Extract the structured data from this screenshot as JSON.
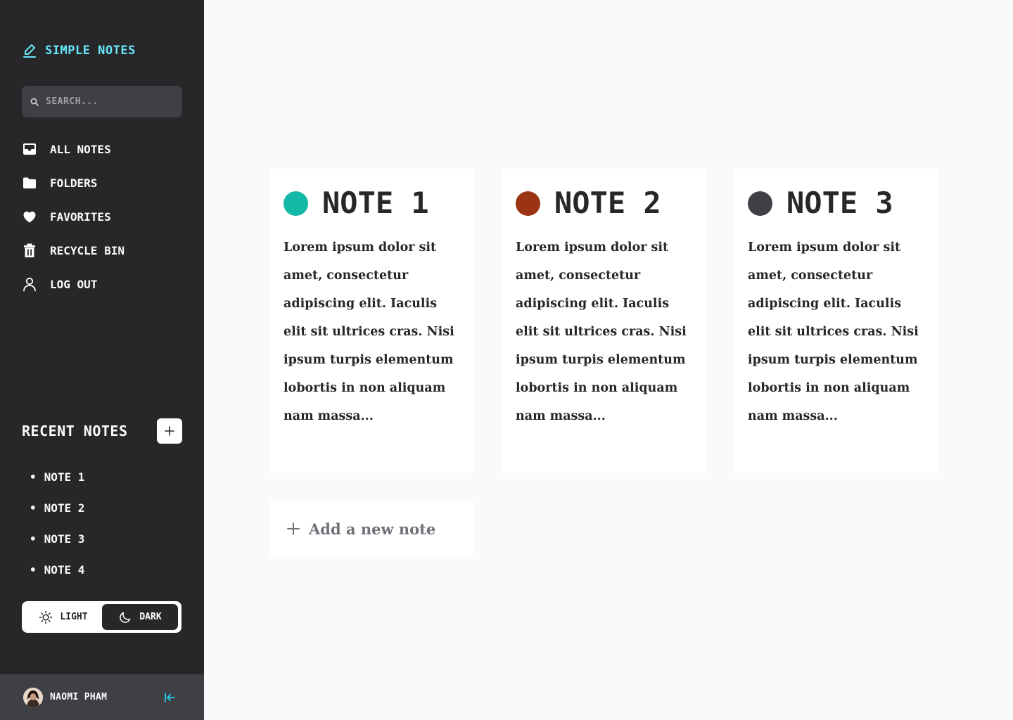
{
  "app": {
    "title": "SIMPLE NOTES"
  },
  "search": {
    "placeholder": "SEARCH..."
  },
  "nav": {
    "items": [
      {
        "label": "ALL NOTES",
        "icon": "inbox-icon"
      },
      {
        "label": "FOLDERS",
        "icon": "folder-icon"
      },
      {
        "label": "FAVORITES",
        "icon": "heart-icon"
      },
      {
        "label": "RECYCLE BIN",
        "icon": "trash-icon"
      },
      {
        "label": "LOG OUT",
        "icon": "user-icon"
      }
    ]
  },
  "recent": {
    "title": "RECENT NOTES",
    "items": [
      "NOTE 1",
      "NOTE 2",
      "NOTE 3",
      "NOTE 4"
    ]
  },
  "theme": {
    "light_label": "LIGHT",
    "dark_label": "DARK",
    "selected": "DARK"
  },
  "user": {
    "name": "NAOMI PHAM"
  },
  "notes": [
    {
      "title": "NOTE 1",
      "color": "#14b8a6",
      "body": "Lorem ipsum dolor sit amet, consectetur adipiscing elit. Iaculis elit sit ultrices cras. Nisi ipsum turpis elementum lobortis in non aliquam nam massa..."
    },
    {
      "title": "NOTE 2",
      "color": "#9a3412",
      "body": "Lorem ipsum dolor sit amet, consectetur adipiscing elit. Iaculis elit sit ultrices cras. Nisi ipsum turpis elementum lobortis in non aliquam nam massa..."
    },
    {
      "title": "NOTE 3",
      "color": "#3f3f46",
      "body": "Lorem ipsum dolor sit amet, consectetur adipiscing elit. Iaculis elit sit ultrices cras. Nisi ipsum turpis elementum lobortis in non aliquam nam massa..."
    }
  ],
  "add_note": {
    "label": "Add a new note"
  },
  "colors": {
    "sidebar_bg": "#27272a",
    "accent": "#67e8f9",
    "main_bg": "#fafafa"
  }
}
